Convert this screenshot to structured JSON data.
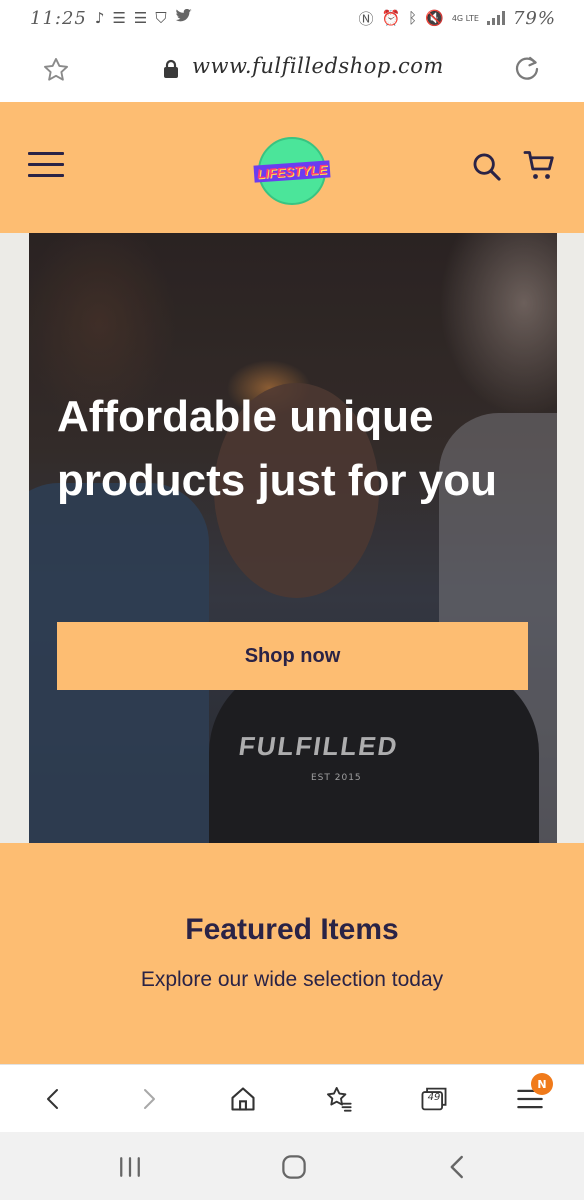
{
  "status_bar": {
    "time": "11:25",
    "battery": "79%",
    "network": "4G LTE",
    "left_icons": [
      "music-note-icon",
      "notification-icon",
      "notification-icon",
      "shield-icon",
      "twitter-icon"
    ],
    "right_icons": [
      "nfc-icon",
      "alarm-icon",
      "bluetooth-icon",
      "mute-icon",
      "signal-icon"
    ]
  },
  "address_bar": {
    "url": "www.fulfilledshop.com",
    "favorite_icon": "star-outline-icon",
    "lock_icon": "lock-icon",
    "reload_icon": "reload-icon"
  },
  "header": {
    "logo_text": "LIFESTYLE",
    "background": "#fdbd72",
    "text_color": "#2a2346"
  },
  "hero": {
    "title": "Affordable unique products just for you",
    "button_label": "Shop now",
    "shirt_print": "FULFILLED",
    "shirt_print_sub": "EST 2015"
  },
  "featured": {
    "title": "Featured Items",
    "subtitle": "Explore our wide selection today"
  },
  "browser_toolbar": {
    "tabs_count": "49",
    "menu_badge": "N"
  },
  "colors": {
    "accent": "#fdbd72",
    "navy": "#2a2346",
    "badge": "#f07a1a",
    "logo_green": "#4be59a"
  }
}
